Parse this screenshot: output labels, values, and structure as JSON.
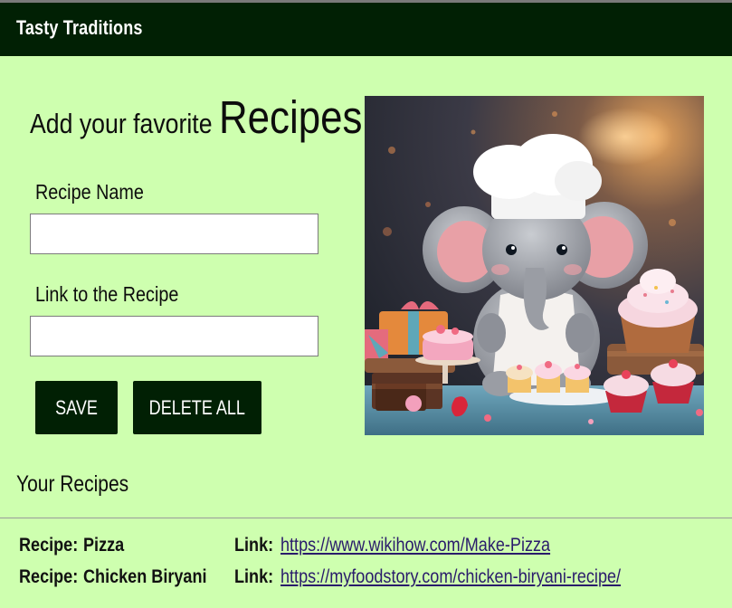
{
  "app": {
    "brand": "Tasty Traditions"
  },
  "form": {
    "heading_prefix": "Add your favorite",
    "heading_emphasis": "Recipes",
    "name_label": "Recipe Name",
    "name_value": "",
    "link_label": "Link to the Recipe",
    "link_value": "",
    "save_label": "SAVE",
    "delete_label": "DELETE ALL"
  },
  "hero": {
    "icon": "elephant-chef-illustration"
  },
  "list": {
    "title": "Your Recipes",
    "recipe_key": "Recipe:",
    "link_key": "Link:",
    "items": [
      {
        "name": "Pizza",
        "url": "https://www.wikihow.com/Make-Pizza"
      },
      {
        "name": "Chicken Biryani",
        "url": "https://myfoodstory.com/chicken-biryani-recipe/"
      }
    ]
  },
  "colors": {
    "background": "#ceffaf",
    "navbar": "#012004",
    "button": "#012004",
    "link": "#2a1b6b"
  }
}
